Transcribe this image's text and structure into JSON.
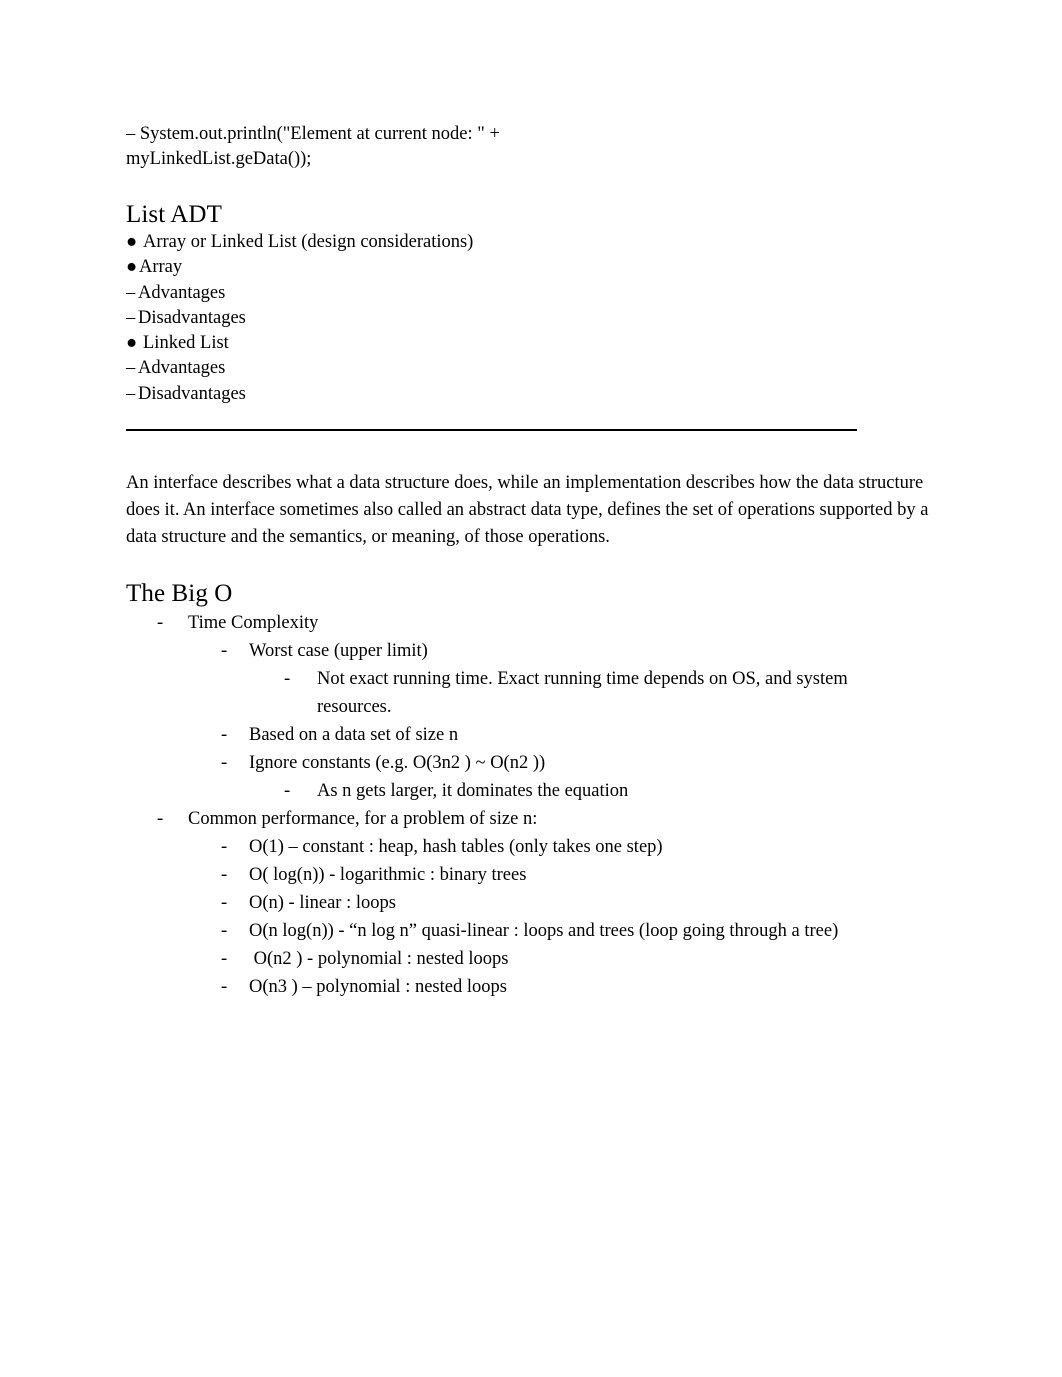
{
  "document": {
    "background_color": "#ffffff",
    "text_color": "#000000",
    "code_lines": [
      "– System.out.println(\"Element at current node: \" +",
      "myLinkedList.geData());"
    ],
    "list_adt": {
      "heading": "List ADT",
      "items": [
        {
          "marker": "●",
          "marker_style": "dot-wide",
          "text": "Array or Linked List (design considerations)"
        },
        {
          "marker": "●",
          "marker_style": "dot-narrow",
          "text": "Array"
        },
        {
          "marker": "–",
          "marker_style": "dash",
          "text": "Advantages"
        },
        {
          "marker": "–",
          "marker_style": "dash",
          "text": "Disadvantages"
        },
        {
          "marker": "●",
          "marker_style": "dot-wide",
          "text": "Linked List"
        },
        {
          "marker": "–",
          "marker_style": "dash",
          "text": "Advantages"
        },
        {
          "marker": "–",
          "marker_style": "dash",
          "text": "Disadvantages"
        }
      ]
    },
    "paragraph": "An interface describes what a data structure does, while an implementation describes how the data structure does it. An interface sometimes also called an abstract data type, defines the set of operations supported by a data structure and the semantics, or meaning, of those operations.",
    "big_o": {
      "heading": "The Big O",
      "items": [
        {
          "level": 1,
          "marker": "-",
          "text": "Time Complexity"
        },
        {
          "level": 2,
          "marker": "-",
          "text": "Worst case (upper limit)"
        },
        {
          "level": 3,
          "marker": "-",
          "text": "Not exact running time. Exact running time depends on OS, and system resources."
        },
        {
          "level": 2,
          "marker": "-",
          "text": "Based on a data set of size n"
        },
        {
          "level": 2,
          "marker": "-",
          "text": "Ignore constants (e.g. O(3n2 ) ~ O(n2 ))"
        },
        {
          "level": 3,
          "marker": "-",
          "text": "As n gets larger, it dominates the equation"
        },
        {
          "level": 1,
          "marker": "-",
          "text": "Common performance, for a problem of size n:"
        },
        {
          "level": 2,
          "marker": "-",
          "text": "O(1) – constant : heap, hash tables (only takes one step)"
        },
        {
          "level": 2,
          "marker": "-",
          "text": "O( log(n)) - logarithmic : binary trees"
        },
        {
          "level": 2,
          "marker": "-",
          "text": "O(n) - linear : loops"
        },
        {
          "level": 2,
          "marker": "-",
          "text": "O(n log(n)) - “n log n” quasi-linear : loops and trees (loop going through a tree)"
        },
        {
          "level": 2,
          "marker": "-",
          "text": " O(n2 ) - polynomial : nested loops"
        },
        {
          "level": 2,
          "marker": "-",
          "text": "O(n3 ) – polynomial : nested loops"
        }
      ]
    }
  }
}
